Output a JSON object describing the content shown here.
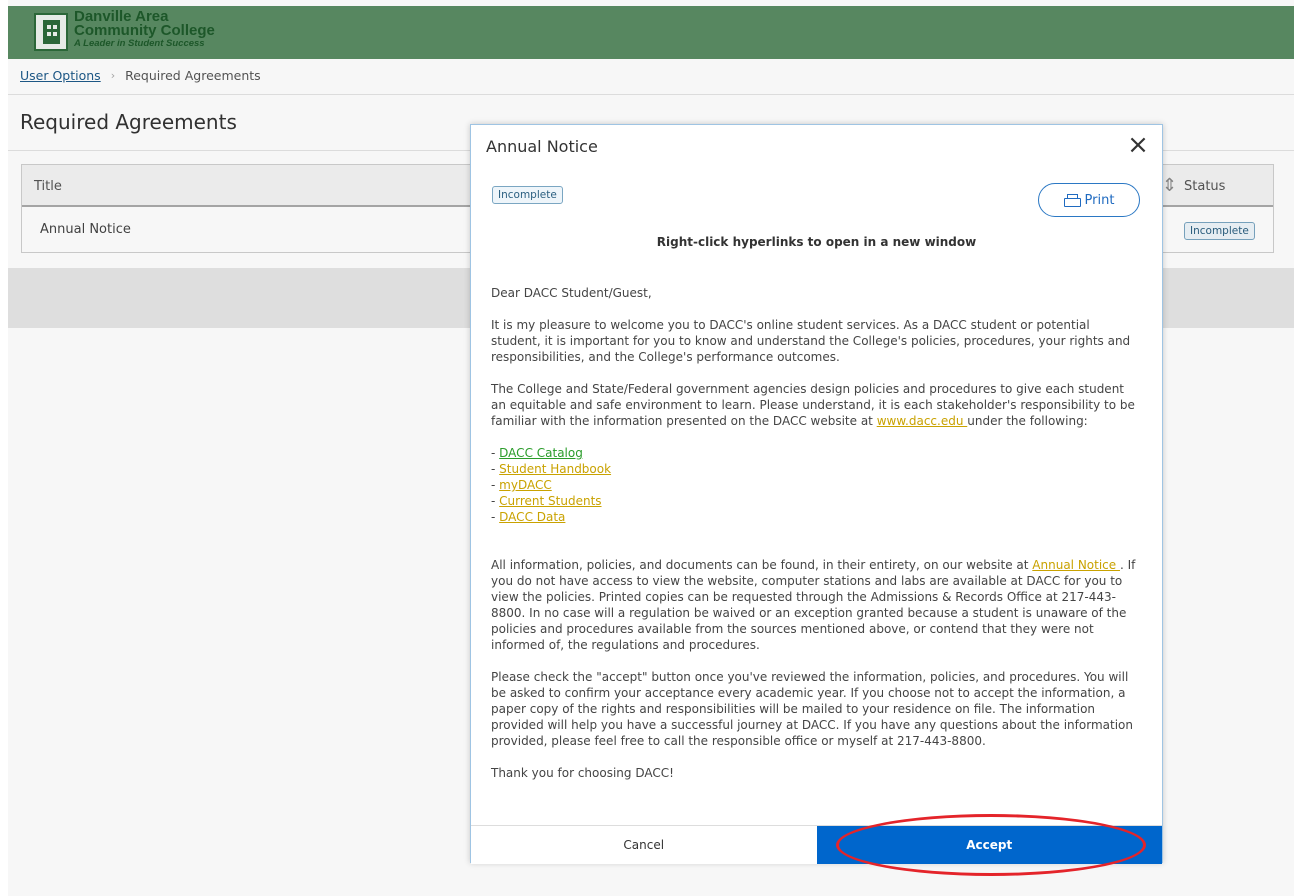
{
  "header": {
    "brand_line1": "Danville Area",
    "brand_line2": "Community College",
    "brand_tagline": "A Leader in Student Success",
    "bg_color": "#5a8c64"
  },
  "breadcrumb": {
    "parent": "User Options",
    "current": "Required Agreements"
  },
  "page": {
    "title": "Required Agreements"
  },
  "table": {
    "headers": [
      "Title",
      "Status"
    ],
    "rows": [
      {
        "title": "Annual Notice",
        "status": "Incomplete"
      }
    ]
  },
  "modal": {
    "title": "Annual Notice",
    "status_badge": "Incomplete",
    "print_label": "Print",
    "hint": "Right-click hyperlinks to open in a new window",
    "greeting": "Dear DACC Student/Guest,",
    "para1": "It is my pleasure to welcome you to DACC's online student services. As a DACC student or potential student, it is important for you to know and understand the College's policies, procedures, your rights and responsibilities, and the College's performance outcomes.",
    "para2_pre": "The College and State/Federal government agencies design policies and procedures to give each student an equitable and safe environment to learn. Please understand, it is each stakeholder's responsibility to be familiar with the information presented on the DACC website at ",
    "para2_link": "www.dacc.edu ",
    "para2_post": "under the following:",
    "links": [
      "DACC Catalog",
      "Student Handbook",
      "myDACC",
      "Current Students",
      "DACC Data"
    ],
    "para3_pre": "All information, policies, and documents can be found, in their entirety, on our website at ",
    "para3_link": "Annual Notice ",
    "para3_post": ". If you do not have access to view the website, computer stations and labs are available at DACC for you to view the policies. Printed copies can be requested through the Admissions & Records Office at 217-443-8800. In no case will a regulation be waived or an exception granted because a student is unaware of the policies and procedures available from the sources mentioned above, or contend that they were not informed of, the regulations and procedures.",
    "para4": "Please check the \"accept\" button once you've reviewed the information, policies, and procedures. You will be asked to confirm your acceptance every academic year. If you choose not to accept the information, a paper copy of the rights and responsibilities will be mailed to your residence on file. The information provided will help you have a successful journey at DACC. If you have any questions about the information provided, please feel free to call the responsible office or myself at 217-443-8800.",
    "closing": "Thank you for choosing DACC!",
    "cancel_label": "Cancel",
    "accept_label": "Accept",
    "accept_color": "#0066cc"
  },
  "annotation": {
    "color": "#e4242a"
  }
}
